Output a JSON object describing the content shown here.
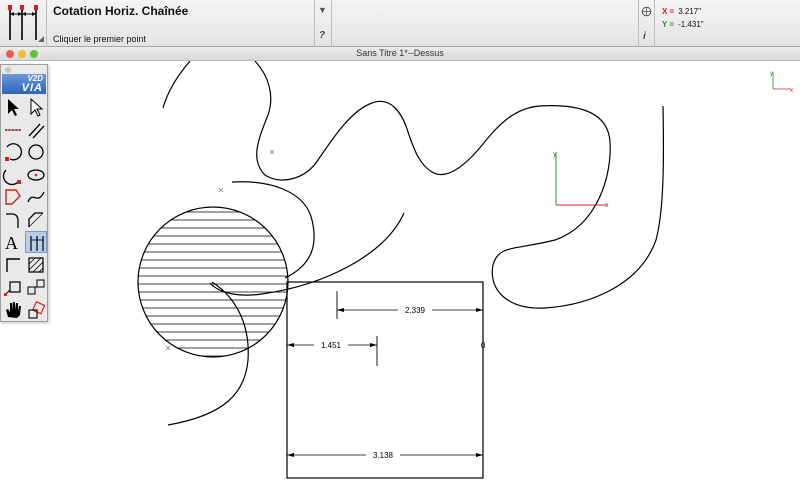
{
  "toolbar": {
    "tool_title": "Cotation Horiz. Chaînée",
    "prompt": "Cliquer le premier point",
    "dropdown_icon": "triangle-down-icon",
    "help_label": "?",
    "info_label": "i",
    "coords": {
      "x_label": "X =",
      "x_value": "3.217\"",
      "y_label": "Y =",
      "y_value": "-1.431\"",
      "x_color": "#d32020",
      "y_color": "#1c9a1c"
    }
  },
  "window": {
    "title": "Sans Titre 1*--Dessus"
  },
  "palette": {
    "logo_top": "V2D",
    "logo_bottom": "VIA",
    "tools": [
      {
        "name": "arrow-select-icon"
      },
      {
        "name": "hollow-arrow-select-icon"
      },
      {
        "name": "dashed-line-icon"
      },
      {
        "name": "parallel-lines-icon"
      },
      {
        "name": "arc-icon"
      },
      {
        "name": "circle-icon"
      },
      {
        "name": "arc-three-point-icon"
      },
      {
        "name": "ellipse-icon"
      },
      {
        "name": "polygon-icon"
      },
      {
        "name": "spline-icon"
      },
      {
        "name": "fillet-icon"
      },
      {
        "name": "chamfer-icon"
      },
      {
        "name": "text-icon"
      },
      {
        "name": "dimension-icon",
        "active": true
      },
      {
        "name": "corner-icon"
      },
      {
        "name": "hatch-icon"
      },
      {
        "name": "transform-icon"
      },
      {
        "name": "multi-copy-icon"
      },
      {
        "name": "hand-pan-icon"
      },
      {
        "name": "rotate-icon"
      }
    ]
  },
  "drawing": {
    "dimensions": [
      "2.339",
      "1.451",
      "3.138"
    ],
    "axis_x_label": "x",
    "axis_y_label": "y",
    "origin_marker_x": "x",
    "origin_marker_y": "y",
    "stray_point_label": "0"
  }
}
